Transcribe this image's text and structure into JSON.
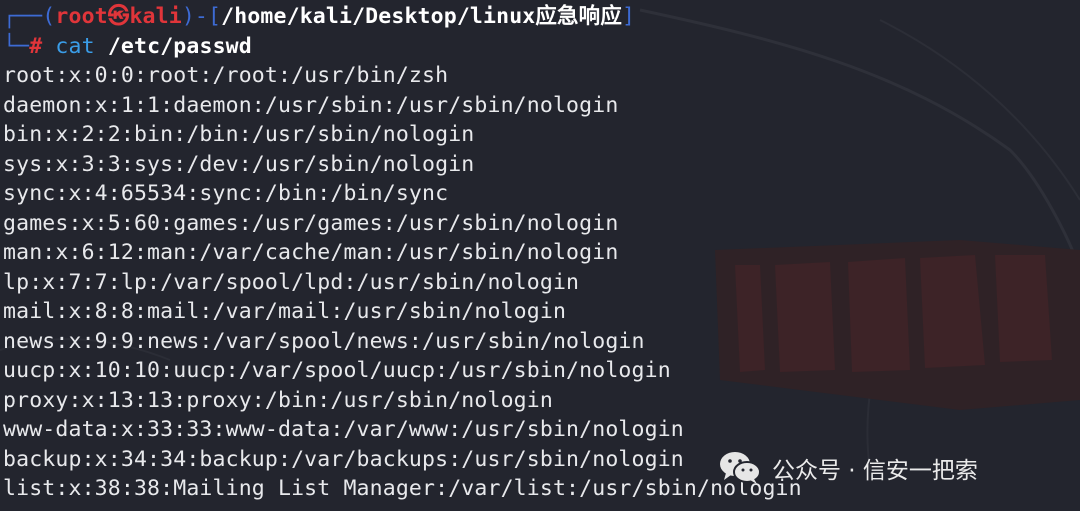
{
  "prompt": {
    "frame_top": "┌──(",
    "user": "root",
    "skull": "㉿",
    "host": "kali",
    "close_paren": ")-[",
    "cwd": "/home/kali/Desktop/linux应急响应",
    "close_bracket": "]",
    "frame_bottom": "└─",
    "hash": "#",
    "command": "cat",
    "argument": "/etc/passwd"
  },
  "output": [
    "root:x:0:0:root:/root:/usr/bin/zsh",
    "daemon:x:1:1:daemon:/usr/sbin:/usr/sbin/nologin",
    "bin:x:2:2:bin:/bin:/usr/sbin/nologin",
    "sys:x:3:3:sys:/dev:/usr/sbin/nologin",
    "sync:x:4:65534:sync:/bin:/bin/sync",
    "games:x:5:60:games:/usr/games:/usr/sbin/nologin",
    "man:x:6:12:man:/var/cache/man:/usr/sbin/nologin",
    "lp:x:7:7:lp:/var/spool/lpd:/usr/sbin/nologin",
    "mail:x:8:8:mail:/var/mail:/usr/sbin/nologin",
    "news:x:9:9:news:/var/spool/news:/usr/sbin/nologin",
    "uucp:x:10:10:uucp:/var/spool/uucp:/usr/sbin/nologin",
    "proxy:x:13:13:proxy:/bin:/usr/sbin/nologin",
    "www-data:x:33:33:www-data:/var/www:/usr/sbin/nologin",
    "backup:x:34:34:backup:/var/backups:/usr/sbin/nologin",
    "list:x:38:38:Mailing List Manager:/var/list:/usr/sbin/nologin"
  ],
  "watermark": {
    "icon": "wechat-icon",
    "text": "公众号 · 信安一把索"
  },
  "colors": {
    "background": "#23252e",
    "prompt_red": "#e0353a",
    "prompt_blue": "#3d6bd4",
    "command_blue": "#3a9de8",
    "text": "#e8e9ec"
  }
}
